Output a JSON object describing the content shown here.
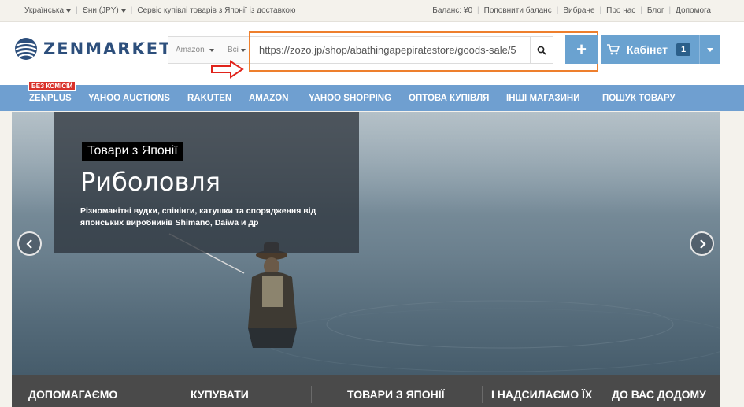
{
  "topbar": {
    "language": "Українська",
    "currency": "Єни (JPY)",
    "tagline": "Сервіс купівлі товарів з Японії із доставкою",
    "balance": "Баланс: ¥0",
    "topup": "Поповнити баланс",
    "favorites": "Вибране",
    "about": "Про нас",
    "blog": "Блог",
    "help": "Допомога"
  },
  "header": {
    "logo": "ZENMARKET",
    "store_select": "Amazon",
    "category_select": "Всі",
    "search_value": "https://zozo.jp/shop/abathingapepiratestore/goods-sale/5",
    "add_label": "+",
    "cabinet_label": "Кабінет",
    "cabinet_count": "1"
  },
  "nav": {
    "badge": "БЕЗ КОМІСІЙ",
    "items": [
      "ZENPLUS",
      "YAHOO AUCTIONS",
      "RAKUTEN",
      "AMAZON",
      "YAHOO SHOPPING",
      "ОПТОВА КУПІВЛЯ",
      "ІНШІ МАГАЗИНИ",
      "ПОШУК ТОВАРУ"
    ]
  },
  "hero": {
    "tag": "Товари з Японії",
    "title": "Риболовля",
    "description": "Різноманітні вудки, спінінги, катушки та спорядження від японських виробників Shimano, Daiwa и др"
  },
  "bottom": {
    "items": [
      "ДОПОМАГАЄМО",
      "КУПУВАТИ",
      "ТОВАРИ З ЯПОНІЇ",
      "І НАДСИЛАЄМО ЇХ",
      "ДО ВАС ДОДОМУ"
    ]
  },
  "colors": {
    "accent": "#6aa2d0",
    "nav": "#6f9fd0",
    "highlight": "#ee7f2d",
    "arrow": "#e0241c",
    "badge": "#d9322b"
  }
}
